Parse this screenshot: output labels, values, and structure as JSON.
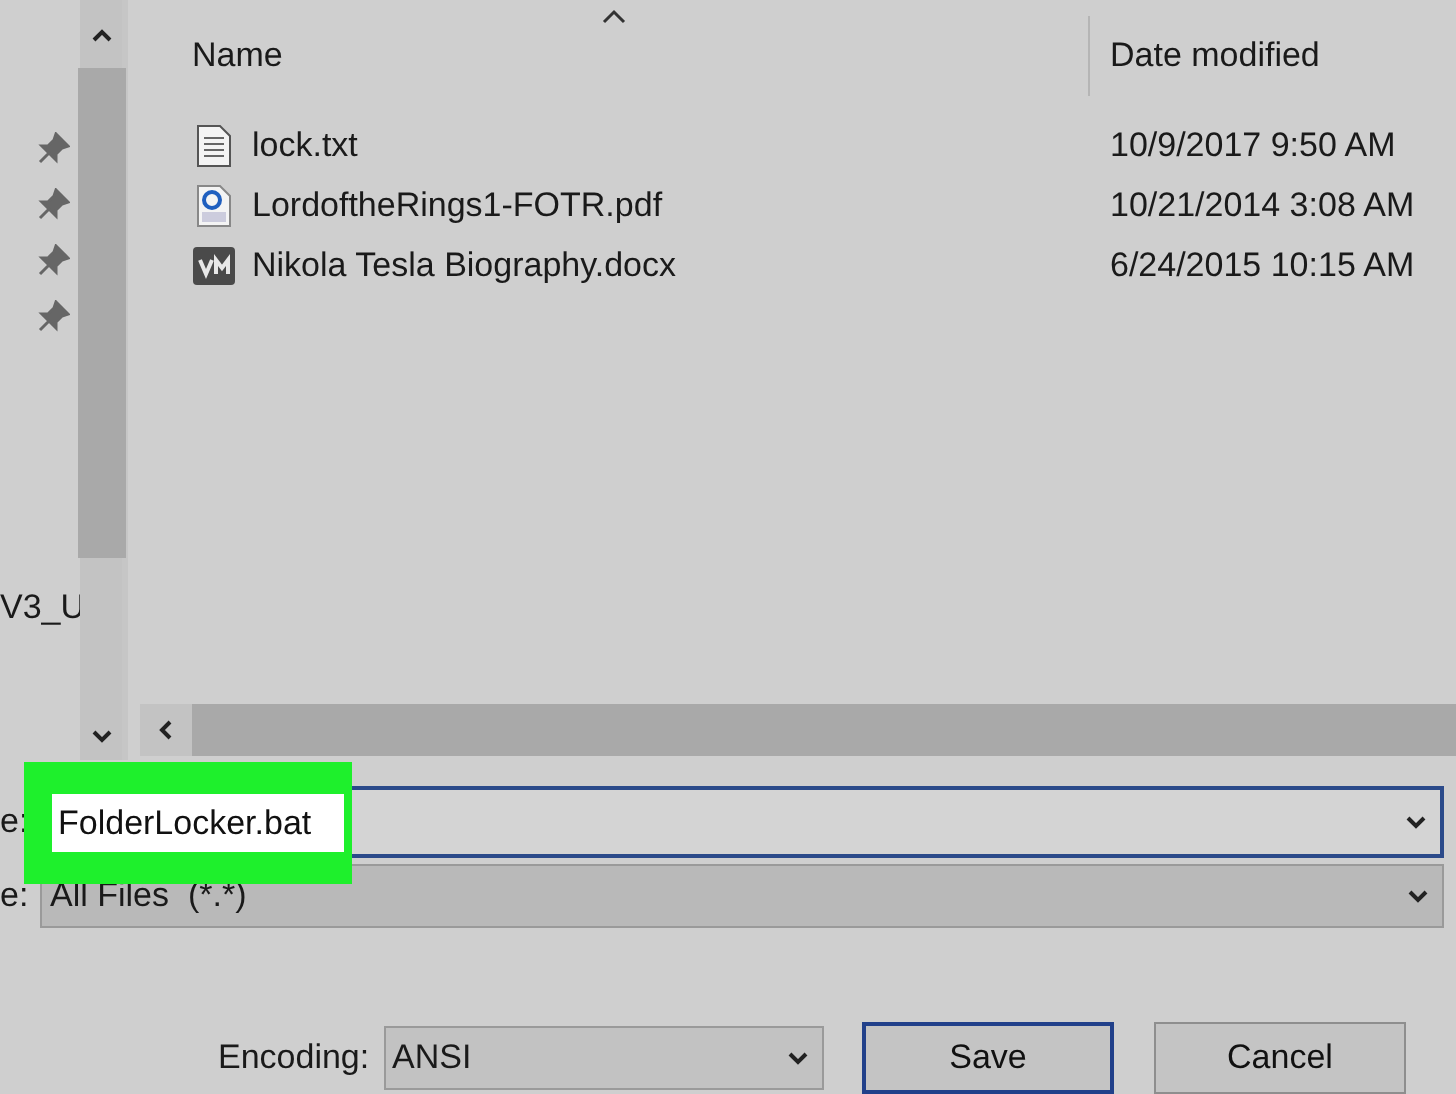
{
  "nav": {
    "items": [
      {
        "pinned": true
      },
      {
        "pinned": true
      },
      {
        "pinned": true
      },
      {
        "pinned": true
      }
    ],
    "label": "V3_U"
  },
  "columns": [
    {
      "label": "Name",
      "sorted": true
    },
    {
      "label": "Date modified",
      "sorted": false
    }
  ],
  "rows": [
    {
      "kind": "text",
      "name": "lock.txt",
      "date": "10/9/2017 9:50 AM"
    },
    {
      "kind": "pdf",
      "name": "LordoftheRings1-FOTR.pdf",
      "date": "10/21/2014 3:08 AM"
    },
    {
      "kind": "vm",
      "name": "Nikola Tesla Biography.docx",
      "date": "6/24/2015 10:15 AM"
    }
  ],
  "file_name": {
    "label": "e:",
    "value": "FolderLocker.bat",
    "highlighted": true
  },
  "save_as_type": {
    "label": "e:",
    "value": "All Files  (*.*)"
  },
  "encoding": {
    "label": "Encoding:",
    "value": "ANSI"
  },
  "buttons": [
    {
      "label": "Save",
      "default": true
    },
    {
      "label": "Cancel",
      "default": false
    }
  ]
}
